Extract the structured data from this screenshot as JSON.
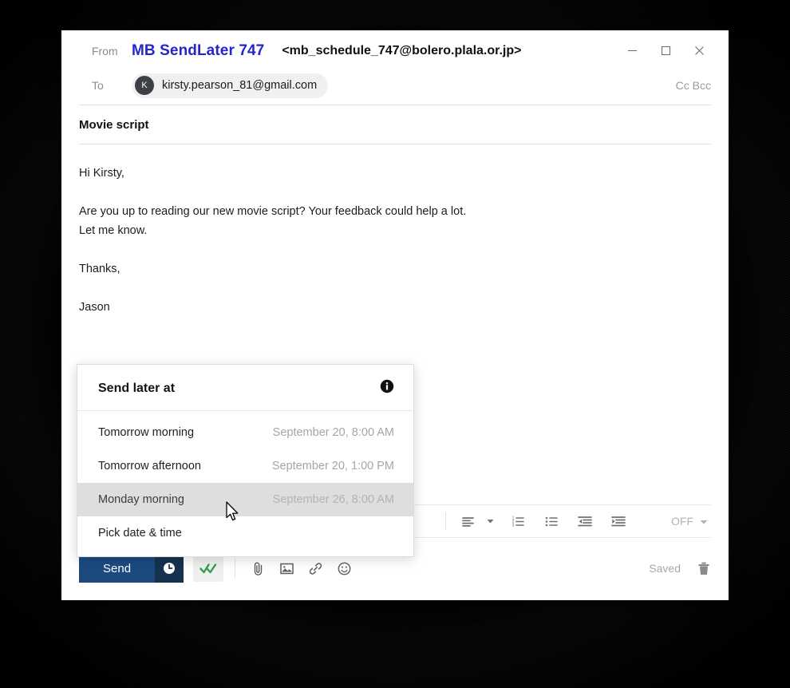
{
  "window": {
    "controls": [
      {
        "name": "minimize",
        "label": "Minimize"
      },
      {
        "name": "maximize",
        "label": "Maximize"
      },
      {
        "name": "close",
        "label": "Close"
      }
    ]
  },
  "header": {
    "from_label": "From",
    "sender_name": "MB SendLater 747",
    "sender_email": "<mb_schedule_747@bolero.plala.or.jp>",
    "sender_name_color": "#2226cc",
    "to_label": "To",
    "recipient_initial": "K",
    "recipient_email": "kirsty.pearson_81@gmail.com",
    "cc_bcc_label": "Cc Bcc"
  },
  "subject": {
    "text": "Movie script"
  },
  "body": {
    "lines": [
      "Hi Kirsty,",
      "",
      "Are you up to reading our new movie script? Your feedback could help a lot.",
      "Let me know.",
      "",
      "Thanks,",
      "",
      "Jason"
    ]
  },
  "send_later_panel": {
    "title": "Send later at",
    "info_icon": "info-icon",
    "items": [
      {
        "label": "Tomorrow morning",
        "date": "September 20, 8:00 AM",
        "active": false
      },
      {
        "label": "Tomorrow afternoon",
        "date": "September 20, 1:00 PM",
        "active": false
      },
      {
        "label": "Monday morning",
        "date": "September 26, 8:00 AM",
        "active": true
      },
      {
        "label": "Pick date & time",
        "date": "",
        "active": false
      }
    ]
  },
  "format_toolbar": {
    "buttons": [
      {
        "name": "align-icon",
        "label": "Align"
      },
      {
        "name": "numbered-list-icon",
        "label": "Numbered list"
      },
      {
        "name": "bulleted-list-icon",
        "label": "Bulleted list"
      },
      {
        "name": "outdent-icon",
        "label": "Decrease indent"
      },
      {
        "name": "indent-icon",
        "label": "Increase indent"
      }
    ],
    "tracking_value": "OFF"
  },
  "action_bar": {
    "send_label": "Send",
    "send_button_color": "#1c4a7e",
    "send_schedule_color": "#15334f",
    "schedule_icon": "clock-icon",
    "track_icon": "double-check-icon",
    "track_icon_color": "#2e9e45",
    "tools": [
      {
        "name": "attachment-icon",
        "label": "Attach file"
      },
      {
        "name": "image-icon",
        "label": "Insert image"
      },
      {
        "name": "link-icon",
        "label": "Insert link"
      },
      {
        "name": "emoji-icon",
        "label": "Insert emoji"
      }
    ],
    "saved_label": "Saved",
    "trash_icon": "trash-icon"
  }
}
